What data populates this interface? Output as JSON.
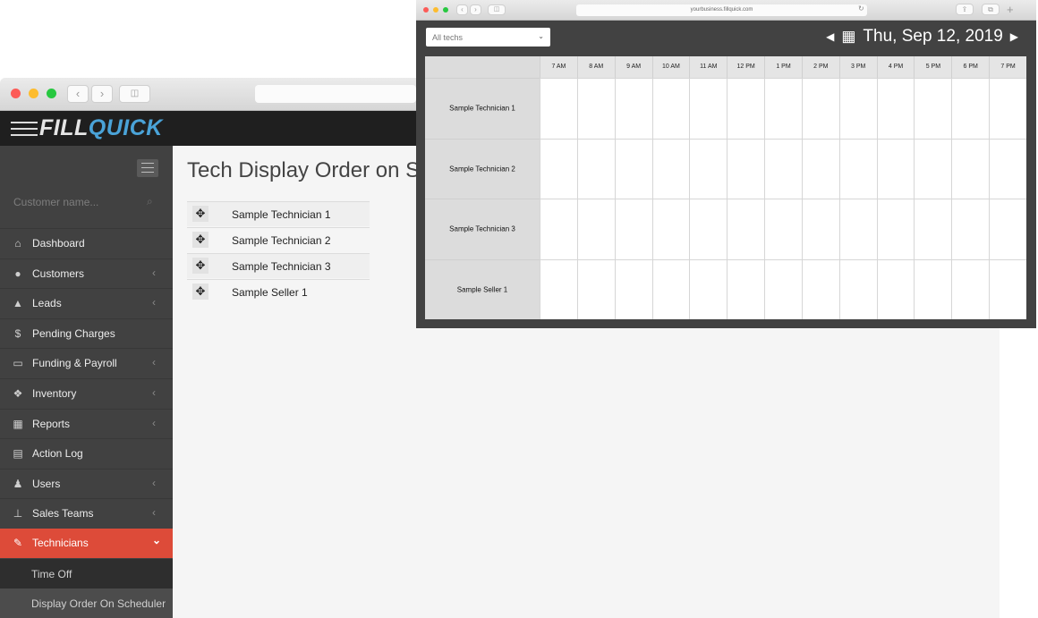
{
  "back": {
    "brand": {
      "part1": "FILL",
      "part2": "QUICK"
    },
    "search": {
      "placeholder": "Customer name..."
    },
    "nav": [
      {
        "label": "Dashboard",
        "icon": "home-icon",
        "glyph": "⌂",
        "chevron": false,
        "name": "sidebar-item-dashboard"
      },
      {
        "label": "Customers",
        "icon": "user-icon",
        "glyph": "●",
        "chevron": true,
        "name": "sidebar-item-customers"
      },
      {
        "label": "Leads",
        "icon": "binoculars-icon",
        "glyph": "▲",
        "chevron": true,
        "name": "sidebar-item-leads"
      },
      {
        "label": "Pending Charges",
        "icon": "dollar-icon",
        "glyph": "$",
        "chevron": false,
        "name": "sidebar-item-pending-charges"
      },
      {
        "label": "Funding & Payroll",
        "icon": "money-icon",
        "glyph": "▭",
        "chevron": true,
        "name": "sidebar-item-funding-payroll"
      },
      {
        "label": "Inventory",
        "icon": "cubes-icon",
        "glyph": "❖",
        "chevron": true,
        "name": "sidebar-item-inventory"
      },
      {
        "label": "Reports",
        "icon": "table-icon",
        "glyph": "▦",
        "chevron": true,
        "name": "sidebar-item-reports"
      },
      {
        "label": "Action Log",
        "icon": "book-icon",
        "glyph": "▤",
        "chevron": false,
        "name": "sidebar-item-action-log"
      },
      {
        "label": "Users",
        "icon": "male-icon",
        "glyph": "♟",
        "chevron": true,
        "name": "sidebar-item-users"
      },
      {
        "label": "Sales Teams",
        "icon": "sitemap-icon",
        "glyph": "⊥",
        "chevron": true,
        "name": "sidebar-item-sales-teams"
      },
      {
        "label": "Technicians",
        "icon": "wrench-icon",
        "glyph": "✎",
        "chevron": true,
        "name": "sidebar-item-technicians",
        "active": true
      }
    ],
    "subnav": [
      {
        "label": "Time Off"
      },
      {
        "label": "Display Order On Scheduler",
        "selected": true
      }
    ],
    "page_title": "Tech Display Order on Scheduler",
    "order_list": [
      "Sample Technician 1",
      "Sample Technician 2",
      "Sample Technician 3",
      "Sample Seller 1"
    ]
  },
  "front": {
    "url": "yourbusiness.fillquick.com",
    "tech_filter": "All techs",
    "date": "Thu, Sep 12, 2019",
    "hours": [
      "7 AM",
      "8 AM",
      "9 AM",
      "10 AM",
      "11 AM",
      "12 PM",
      "1 PM",
      "2 PM",
      "3 PM",
      "4 PM",
      "5 PM",
      "6 PM",
      "7 PM"
    ],
    "rows": [
      "Sample Technician 1",
      "Sample Technician 2",
      "Sample Technician 3",
      "Sample Seller 1"
    ]
  },
  "colors": {
    "accent_active": "#dd4b39",
    "brand_blue": "#4aa3d8",
    "sidebar_bg": "#414141"
  }
}
